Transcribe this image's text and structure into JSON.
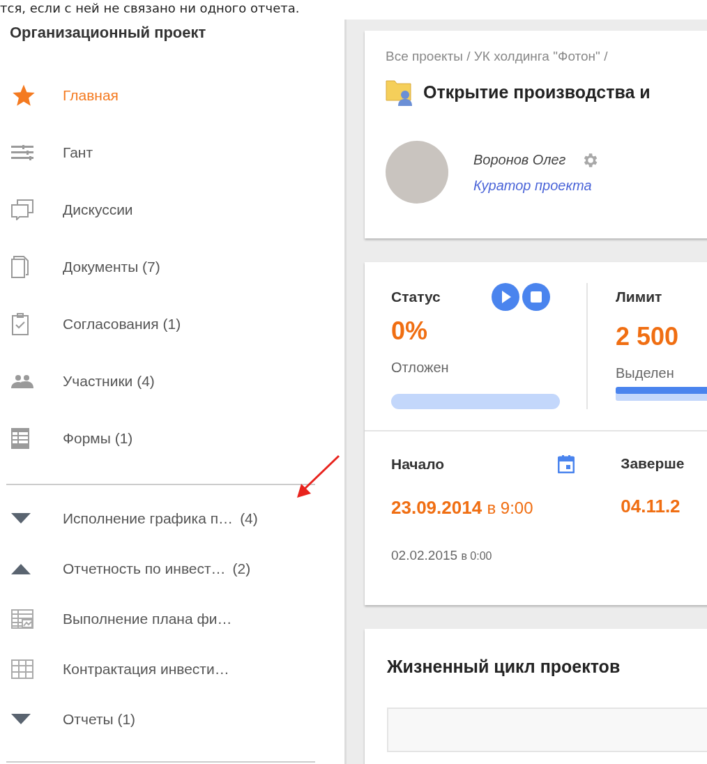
{
  "intro_text": "тся, если с ней не связано ни одного отчета.",
  "sidebar": {
    "title": "Организационный проект",
    "items": [
      {
        "label": "Главная",
        "selected": true
      },
      {
        "label": "Гант",
        "selected": false
      },
      {
        "label": "Дискуссии",
        "selected": false
      },
      {
        "label": "Документы (7)",
        "selected": false
      },
      {
        "label": "Согласования (1)",
        "selected": false
      },
      {
        "label": "Участники (4)",
        "selected": false
      },
      {
        "label": "Формы (1)",
        "selected": false
      }
    ],
    "reports": [
      {
        "kind": "group",
        "label": "Исполнение графика п…",
        "count": "(4)",
        "expanded": false
      },
      {
        "kind": "group",
        "label": "Отчетность по инвест…",
        "count": "(2)",
        "expanded": true
      },
      {
        "kind": "chart",
        "label": "Выполнение плана фи…"
      },
      {
        "kind": "table",
        "label": "Контрактация инвести…"
      },
      {
        "kind": "group",
        "label": "Отчеты (1)",
        "expanded": false
      }
    ]
  },
  "project": {
    "breadcrumb": "Все проекты / УК холдинга \"Фотон\" /",
    "title": "Открытие производства и",
    "person": {
      "name": "Воронов Олег",
      "role": "Куратор проекта"
    }
  },
  "status": {
    "label": "Статус",
    "value": "0%",
    "state": "Отложен",
    "level": 0
  },
  "limit": {
    "label": "Лимит",
    "value": "2 500",
    "caption": "Выделен",
    "level": 1
  },
  "dates": {
    "start_label": "Начало",
    "start_date": "23.09.2014",
    "start_time": "в 9:00",
    "plan_date": "02.02.2015",
    "plan_time": "в 0:00",
    "end_label": "Заверше",
    "end_date": "04.11.2"
  },
  "lifecycle": {
    "title": "Жизненный цикл проектов"
  }
}
